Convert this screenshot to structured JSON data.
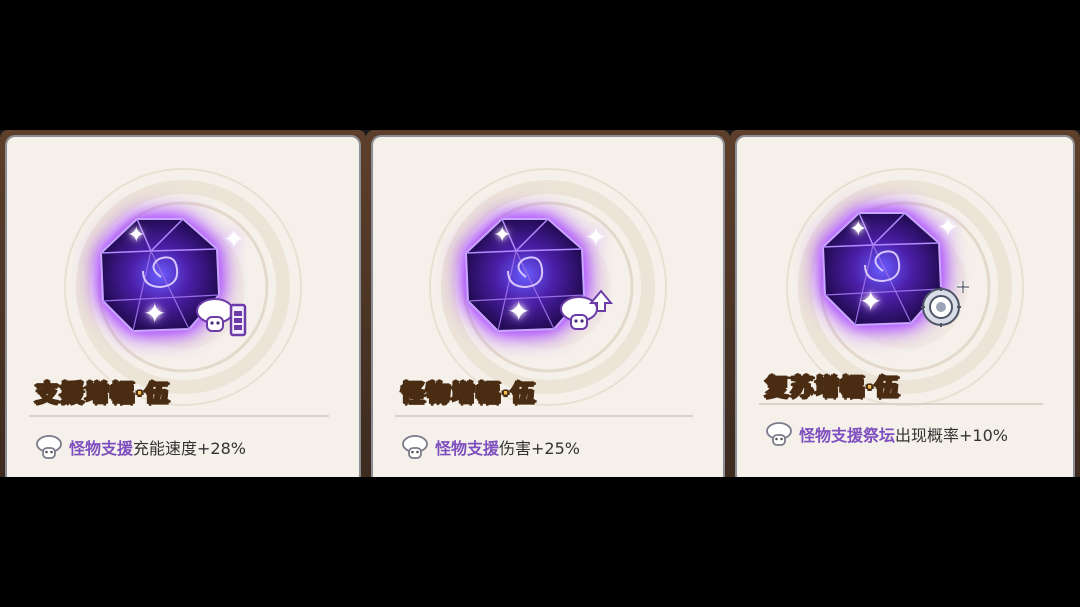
{
  "cards": [
    {
      "title": "支援增幅·伍",
      "highlight": "怪物支援",
      "effect": "充能速度+28%",
      "badge_icon": "battery-icon"
    },
    {
      "title": "怪物增幅·伍",
      "highlight": "怪物支援",
      "effect": "伤害+25%",
      "badge_icon": "arrow-up-icon"
    },
    {
      "title": "复苏增幅·伍",
      "highlight": "怪物支援祭坛",
      "effect": "出现概率+10%",
      "badge_icon": "altar-plus-icon"
    }
  ],
  "colors": {
    "title": "#f2c24a",
    "highlight": "#7e4fbf",
    "gem_glow": "#a03cff",
    "card_bg": "#f5f1ea"
  }
}
